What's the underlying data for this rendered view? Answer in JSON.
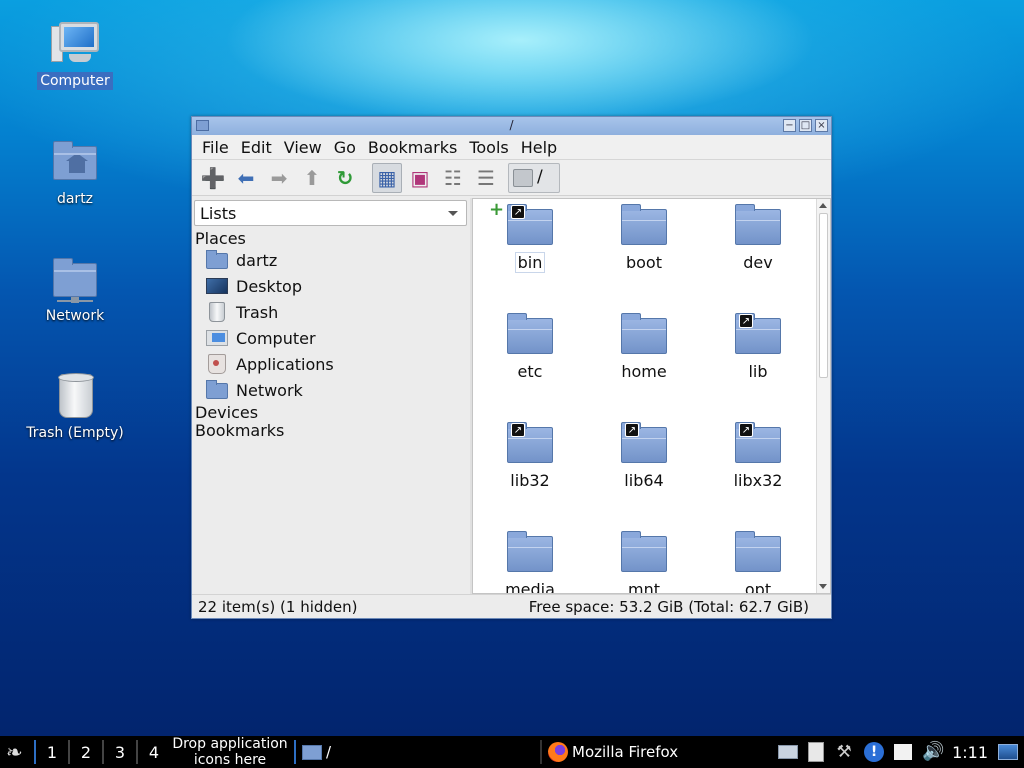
{
  "desktop": {
    "icons": [
      {
        "label": "Computer",
        "icon": "computer-icon"
      },
      {
        "label": "dartz",
        "icon": "home-folder-icon"
      },
      {
        "label": "Network",
        "icon": "network-icon"
      },
      {
        "label": "Trash (Empty)",
        "icon": "trash-icon"
      }
    ]
  },
  "window": {
    "title": "/",
    "buttons": {
      "minimize": "−",
      "maximize": "□",
      "close": "×"
    },
    "menu": [
      {
        "label": "File"
      },
      {
        "label": "Edit"
      },
      {
        "label": "View"
      },
      {
        "label": "Go"
      },
      {
        "label": "Bookmarks"
      },
      {
        "label": "Tools"
      },
      {
        "label": "Help"
      }
    ],
    "toolbar": {
      "new_tab": "new-tab-icon",
      "back": "back-arrow-icon",
      "forward": "forward-arrow-icon",
      "up": "up-arrow-icon",
      "reload": "reload-icon",
      "icon_view": "icon-view-icon",
      "thumbnail_view": "thumbnail-view-icon",
      "compact_view": "compact-view-icon",
      "detailed_view": "detailed-view-icon",
      "path": "/"
    },
    "sidebar": {
      "combo_value": "Lists",
      "places_header": "Places",
      "places": [
        {
          "label": "dartz",
          "icon": "home-folder-icon"
        },
        {
          "label": "Desktop",
          "icon": "desktop-icon"
        },
        {
          "label": "Trash",
          "icon": "trash-icon"
        },
        {
          "label": "Computer",
          "icon": "computer-icon"
        },
        {
          "label": "Applications",
          "icon": "applications-icon"
        },
        {
          "label": "Network",
          "icon": "network-folder-icon"
        }
      ],
      "devices_header": "Devices",
      "bookmarks_header": "Bookmarks"
    },
    "files": [
      {
        "name": "bin",
        "link": true
      },
      {
        "name": "boot",
        "link": false
      },
      {
        "name": "dev",
        "link": false
      },
      {
        "name": "etc",
        "link": false
      },
      {
        "name": "home",
        "link": false
      },
      {
        "name": "lib",
        "link": true
      },
      {
        "name": "lib32",
        "link": true
      },
      {
        "name": "lib64",
        "link": true
      },
      {
        "name": "libx32",
        "link": true
      },
      {
        "name": "media",
        "link": false
      },
      {
        "name": "mnt",
        "link": false
      },
      {
        "name": "opt",
        "link": false
      }
    ],
    "status": {
      "items": "22 item(s) (1 hidden)",
      "free_space": "Free space: 53.2 GiB (Total: 62.7 GiB)"
    }
  },
  "taskbar": {
    "desktops": [
      "1",
      "2",
      "3",
      "4"
    ],
    "drop_hint": "Drop application icons here",
    "tasks": [
      {
        "label": "/",
        "icon": "folder-icon"
      },
      {
        "label": "Mozilla Firefox",
        "icon": "firefox-icon"
      }
    ],
    "clock": "1:11"
  }
}
